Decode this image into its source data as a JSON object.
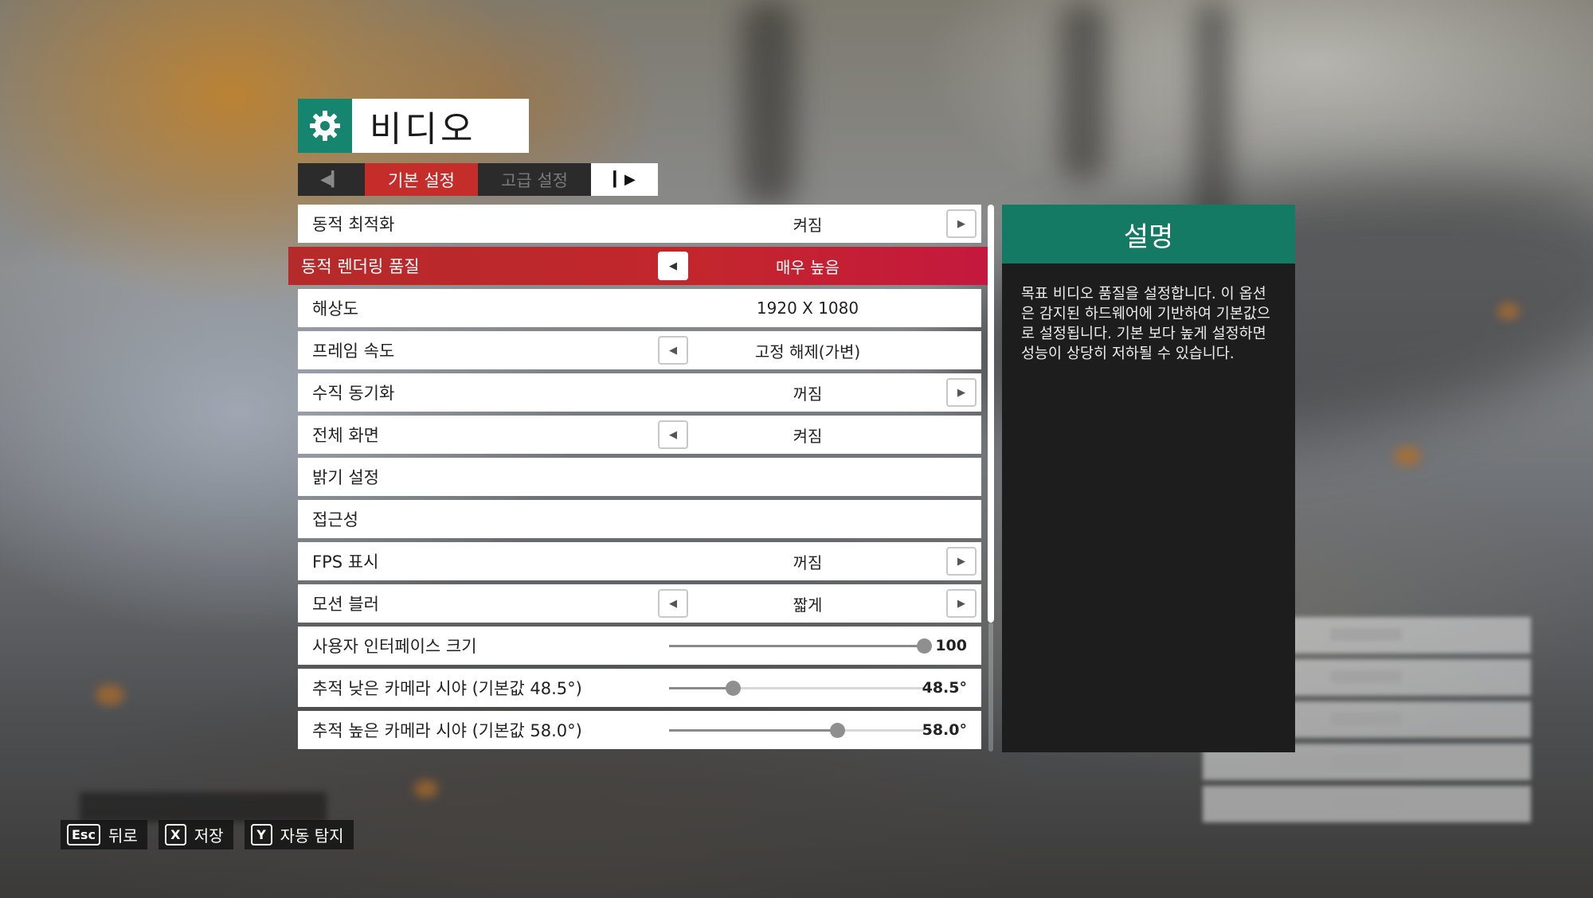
{
  "title": "비디오",
  "tabs": {
    "basic": "기본 설정",
    "advanced": "고급 설정"
  },
  "settings": [
    {
      "label": "동적 최적화",
      "value": "켜짐"
    },
    {
      "label": "동적 렌더링 품질",
      "value": "매우 높음"
    },
    {
      "label": "해상도",
      "value": "1920 X 1080"
    },
    {
      "label": "프레임 속도",
      "value": "고정 해제(가변)"
    },
    {
      "label": "수직 동기화",
      "value": "꺼짐"
    },
    {
      "label": "전체 화면",
      "value": "켜짐"
    },
    {
      "label": "밝기 설정",
      "value": ""
    },
    {
      "label": "접근성",
      "value": ""
    },
    {
      "label": "FPS 표시",
      "value": "꺼짐"
    },
    {
      "label": "모션 블러",
      "value": "짧게"
    }
  ],
  "sliders": [
    {
      "label": "사용자 인터페이스 크기",
      "value": "100",
      "level": 1.0
    },
    {
      "label": "추적 낮은 카메라 시야 (기본값 48.5°)",
      "value": "48.5°",
      "level": 0.25
    },
    {
      "label": "추적 높은 카메라 시야 (기본값 58.0°)",
      "value": "58.0°",
      "level": 0.66
    }
  ],
  "description": {
    "heading": "설명",
    "text": "목표 비디오 품질을 설정합니다. 이 옵션은 감지된 하드웨어에 기반하여 기본값으로 설정됩니다. 기본 보다 높게 설정하면 성능이 상당히 저하될 수 있습니다."
  },
  "hints": [
    {
      "key": "Esc",
      "label": "뒤로"
    },
    {
      "key": "X",
      "label": "저장"
    },
    {
      "key": "Y",
      "label": "자동 탐지"
    }
  ],
  "colors": {
    "accent_red": "#c52d2b",
    "accent_green": "#147a63"
  },
  "icons": {
    "title": "gear-icon",
    "prev_tab": "prev-tab-icon",
    "next_tab": "next-tab-icon"
  }
}
